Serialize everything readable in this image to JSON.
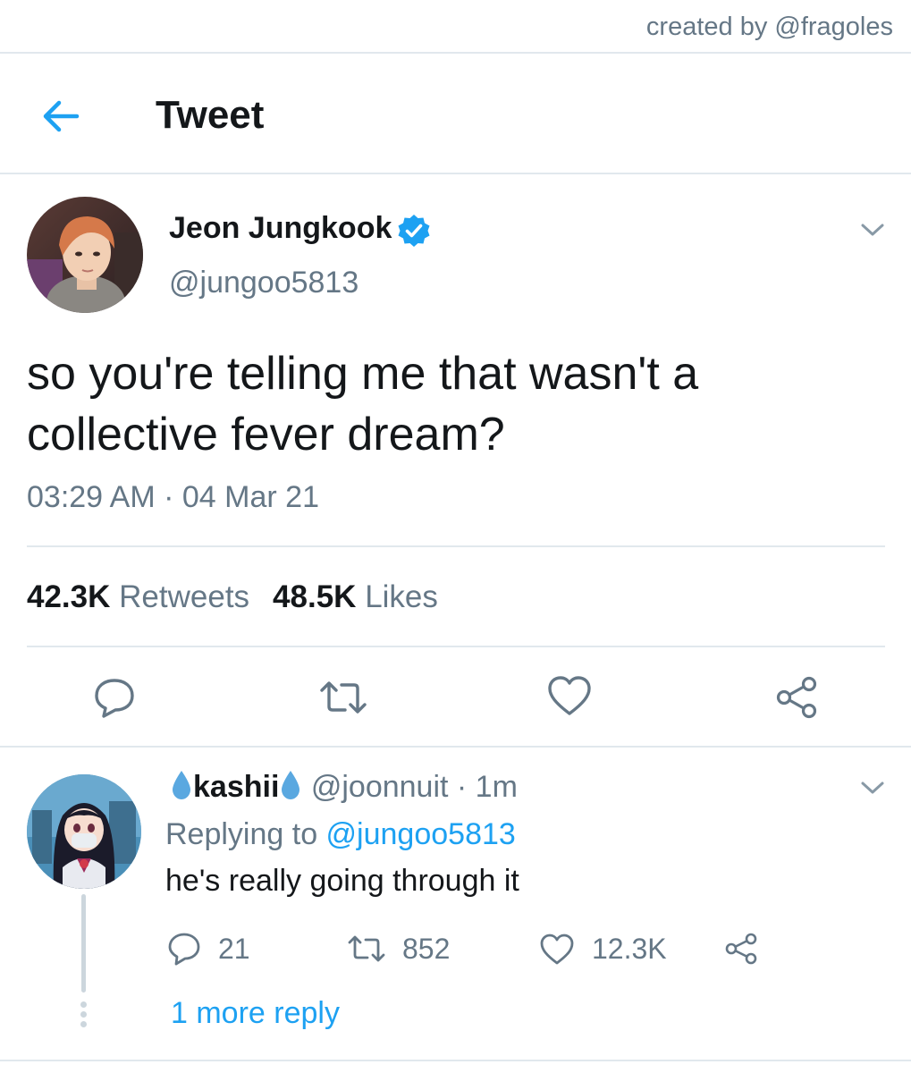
{
  "credit": "created by @fragoles",
  "header": {
    "title": "Tweet"
  },
  "tweet": {
    "author_name": "Jeon Jungkook",
    "author_handle": "@jungoo5813",
    "text": "so you're telling me that wasn't a collective fever dream?",
    "time": "03:29 AM",
    "separator": "·",
    "date": "04 Mar 21",
    "retweets_count": "42.3K",
    "retweets_label": "Retweets",
    "likes_count": "48.5K",
    "likes_label": "Likes"
  },
  "reply": {
    "name": "kashii",
    "handle_time": "@joonnuit · 1m",
    "replying_prefix": "Replying to ",
    "replying_to": "@jungoo5813",
    "text": "he's really going through it",
    "reply_count": "21",
    "retweet_count": "852",
    "like_count": "12.3K",
    "more_replies": "1 more reply"
  },
  "colors": {
    "accent": "#1da1f2",
    "text_secondary": "#657786",
    "divider": "#e1e8ed"
  },
  "icons": {
    "back": "arrow-left-icon",
    "verified": "verified-badge-icon",
    "caret": "chevron-down-icon",
    "reply": "comment-icon",
    "retweet": "retweet-icon",
    "like": "heart-icon",
    "share": "share-icon",
    "emoji": "droplet-icon"
  }
}
